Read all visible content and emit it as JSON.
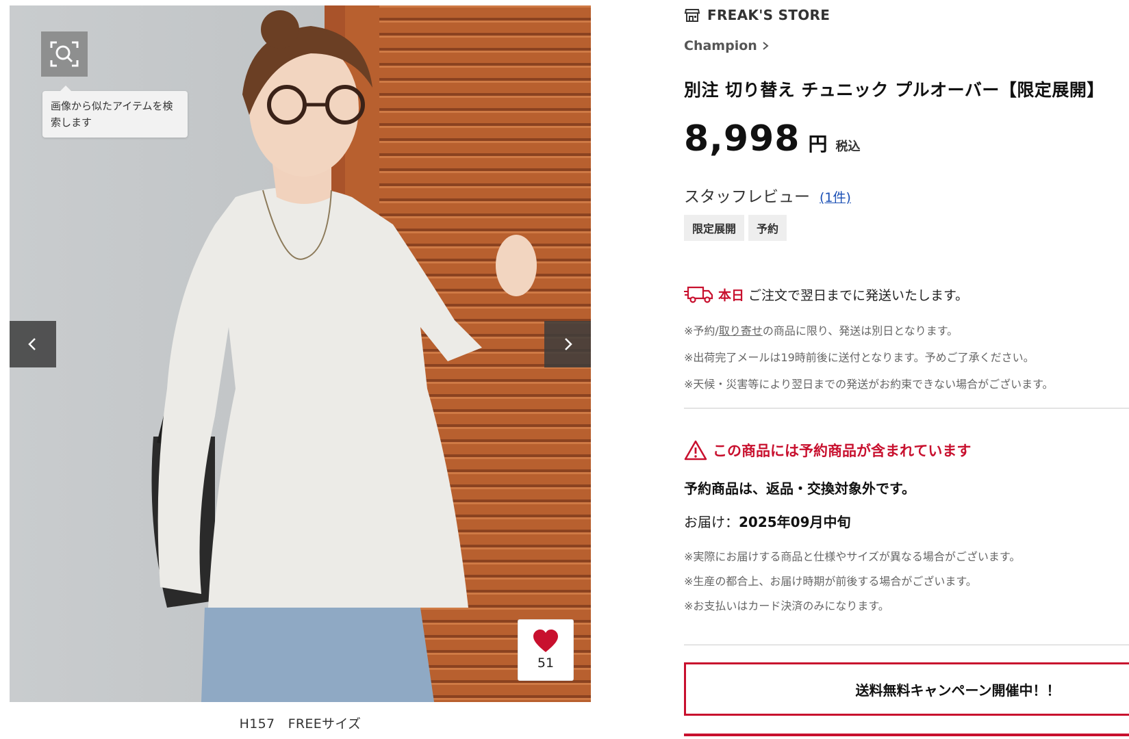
{
  "gallery": {
    "tooltip_text": "画像から似たアイテムを検索します",
    "favorite_count": "51",
    "caption": "H157　FREEサイズ"
  },
  "shop": {
    "name": "FREAK'S STORE"
  },
  "product": {
    "brand": "Champion",
    "title": "別注 切り替え チュニック プルオーバー【限定展開】",
    "price": "8,998",
    "price_unit": "円",
    "tax_label": "税込",
    "review_label": "スタッフレビュー",
    "review_count": "(1件)",
    "tags": [
      "限定展開",
      "予約"
    ]
  },
  "shipping": {
    "today": "本日",
    "message": "ご注文で翌日までに発送いたします。",
    "note1_prefix": "※予約/",
    "note1_link": "取り寄せ",
    "note1_suffix": "の商品に限り、発送は別日となります。",
    "note2": "※出荷完了メールは19時前後に送付となります。予めご了承ください。",
    "note3": "※天候・災害等により翌日までの発送がお約束できない場合がございます。"
  },
  "reservation": {
    "warning": "この商品には予約商品が含まれています",
    "non_returnable": "予約商品は、返品・交換対象外です。",
    "delivery_label": "お届け：",
    "delivery_date": "2025年09月中旬",
    "note1": "※実際にお届けする商品と仕様やサイズが異なる場合がございます。",
    "note2": "※生産の都合上、お届け時期が前後する場合がございます。",
    "note3": "※お支払いはカード決済のみになります。"
  },
  "campaign": {
    "label": "送料無料キャンペーン開催中！！"
  },
  "colors": {
    "accent": "#c8102e",
    "link": "#1a4fb5"
  }
}
